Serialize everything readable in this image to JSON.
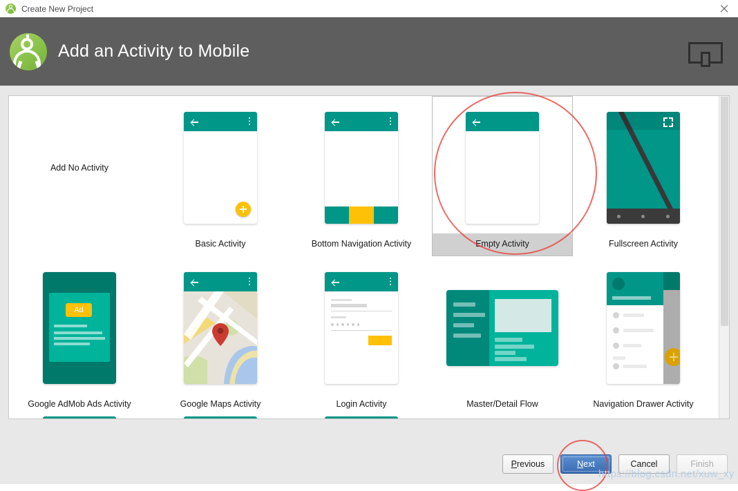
{
  "window": {
    "title": "Create New Project",
    "app_icon": "android-studio-icon",
    "close_icon": "close-icon"
  },
  "header": {
    "title": "Add an Activity to Mobile",
    "logo_icon": "android-studio-logo",
    "device_icon": "tablet-phone-device-icon",
    "background_color": "#5e5e5e"
  },
  "colors": {
    "teal": "#009688",
    "teal_dark": "#00796B",
    "teal_light": "#00B39B",
    "amber": "#FFC107",
    "accent_blue": "#3a6cb0",
    "annotation_red": "#e8403a",
    "selection_gray": "#d0d0d0"
  },
  "gallery": {
    "selected_template": "Empty Activity",
    "rows": [
      [
        {
          "label": "Add No Activity",
          "thumb": "none"
        },
        {
          "label": "Basic Activity",
          "thumb": "basic"
        },
        {
          "label": "Bottom Navigation Activity",
          "thumb": "bottomnav"
        },
        {
          "label": "Empty Activity",
          "thumb": "empty",
          "selected": true
        },
        {
          "label": "Fullscreen Activity",
          "thumb": "fullscreen"
        }
      ],
      [
        {
          "label": "Google AdMob Ads Activity",
          "thumb": "admob",
          "badge": "Ad"
        },
        {
          "label": "Google Maps Activity",
          "thumb": "maps"
        },
        {
          "label": "Login Activity",
          "thumb": "login"
        },
        {
          "label": "Master/Detail Flow",
          "thumb": "masterdetail"
        },
        {
          "label": "Navigation Drawer Activity",
          "thumb": "navdrawer"
        }
      ]
    ],
    "labels": {
      "r0c0": "Add No Activity",
      "r0c1": "Basic Activity",
      "r0c2": "Bottom Navigation Activity",
      "r0c3": "Empty Activity",
      "r0c4": "Fullscreen Activity",
      "r1c0": "Google AdMob Ads Activity",
      "r1c1": "Google Maps Activity",
      "r1c2": "Login Activity",
      "r1c3": "Master/Detail Flow",
      "r1c4": "Navigation Drawer Activity"
    },
    "admob_badge_text": "Ad"
  },
  "footer": {
    "previous_label": "Previous",
    "previous_mnemonic": "P",
    "next_label": "Next",
    "next_mnemonic": "N",
    "cancel_label": "Cancel",
    "finish_label": "Finish",
    "finish_enabled": false,
    "focused_button": "Next"
  },
  "annotations": {
    "circle_empty_activity": "red-circle-around-empty-activity",
    "circle_next_button": "red-circle-around-next-button"
  },
  "watermark": {
    "text": "https://blog.csdn.net/xuw_xy"
  }
}
